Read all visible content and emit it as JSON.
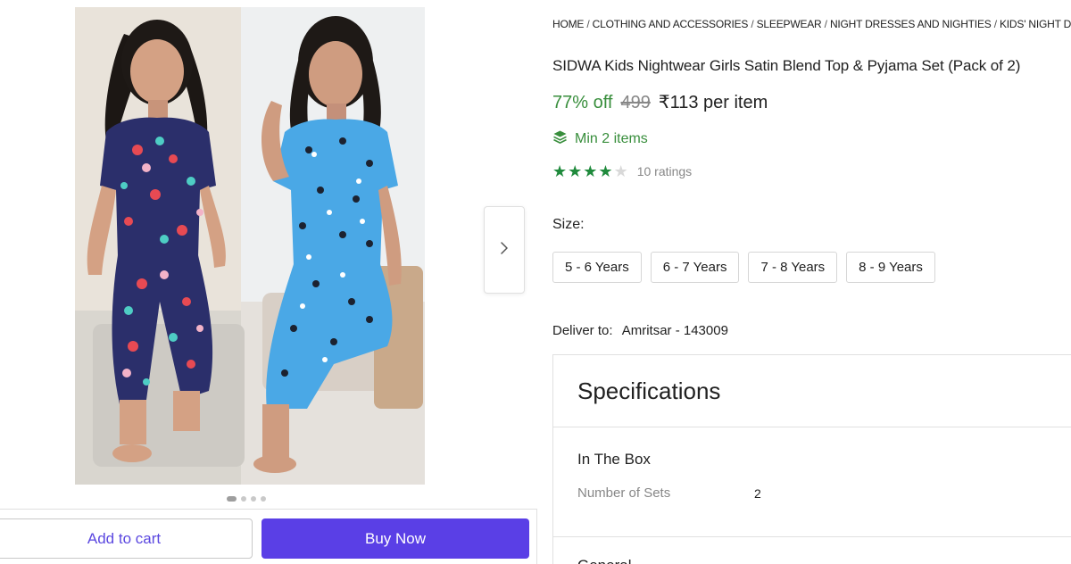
{
  "breadcrumb": [
    {
      "label": "HOME"
    },
    {
      "label": "CLOTHING AND ACCESSORIES"
    },
    {
      "label": "SLEEPWEAR"
    },
    {
      "label": "NIGHT DRESSES AND NIGHTIES"
    },
    {
      "label": "KIDS' NIGHT DRESSES"
    }
  ],
  "breadcrumb_separator": "/",
  "product": {
    "title": "SIDWA Kids Nightwear Girls Satin Blend Top & Pyjama Set (Pack of 2)",
    "discount": "77% off",
    "mrp": "499",
    "price": "₹113 per item",
    "min_order": "Min 2 items",
    "rating_value": 4,
    "rating_max": 5,
    "ratings_count": "10 ratings"
  },
  "size": {
    "label": "Size:",
    "options": [
      "5 - 6 Years",
      "6 - 7 Years",
      "7 - 8 Years",
      "8 - 9 Years"
    ]
  },
  "delivery": {
    "label": "Deliver to:",
    "location": "Amritsar - 143009"
  },
  "specifications": {
    "heading": "Specifications",
    "group_title": "In The Box",
    "rows": [
      {
        "key": "Number of Sets",
        "value": "2"
      }
    ],
    "next_group_title": "General"
  },
  "gallery": {
    "image_count": 4,
    "active_index": 0
  },
  "actions": {
    "add_to_cart": "Add to cart",
    "buy_now": "Buy Now"
  },
  "colors": {
    "accent": "#5a3fe6",
    "discount_green": "#388e3c",
    "star_green": "#1f8a3c",
    "left_outfit": "#2b2f6b",
    "right_outfit": "#4aa8e6"
  },
  "icons": {
    "next": "chevron-right-icon",
    "min_order": "layers-icon",
    "rating": "star-icon"
  }
}
